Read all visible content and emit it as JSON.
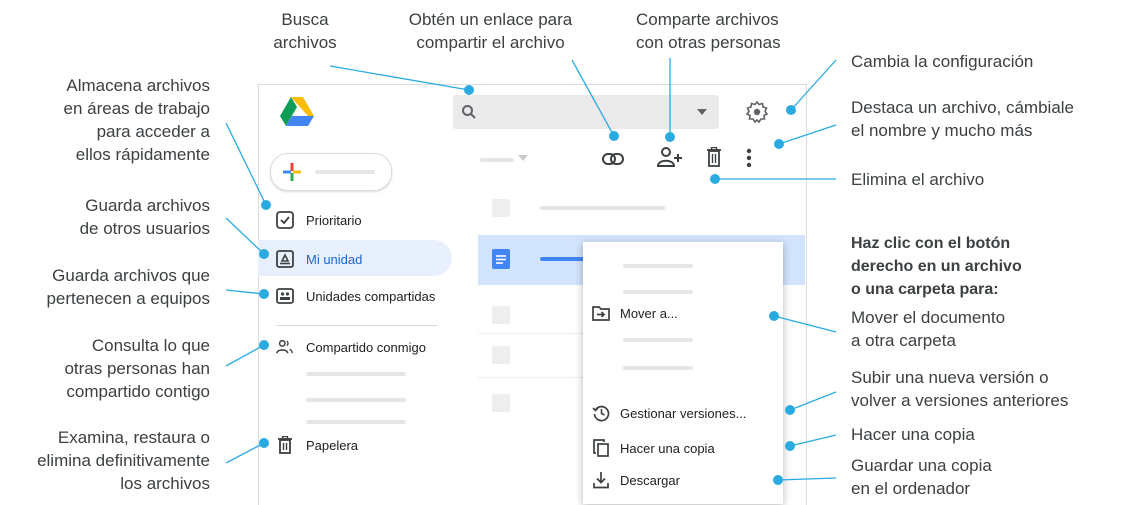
{
  "callouts": {
    "search": [
      "Busca",
      "archivos"
    ],
    "link": [
      "Obtén un enlace para",
      "compartir el archivo"
    ],
    "share": [
      "Comparte archivos",
      "con otras personas"
    ],
    "settings": [
      "Cambia la configuración"
    ],
    "more": [
      "Destaca un archivo, cámbiale",
      "el nombre y mucho más"
    ],
    "delete": [
      "Elimina el archivo"
    ],
    "workspaces": [
      "Almacena archivos",
      "en áreas de trabajo",
      "para acceder a",
      "ellos rápidamente"
    ],
    "mydrive": [
      "Guarda archivos",
      "de otros usuarios"
    ],
    "shareddrives": [
      "Guarda archivos que",
      "pertenecen a equipos"
    ],
    "sharedwithme": [
      "Consulta lo que",
      "otras personas han",
      "compartido contigo"
    ],
    "trash": [
      "Examina, restaura o",
      "elimina definitivamente",
      "los archivos"
    ],
    "rightclick": [
      "Haz clic con el botón",
      "derecho en un archivo",
      "o una carpeta para:"
    ],
    "move": [
      "Mover el documento",
      "a otra carpeta"
    ],
    "versions": [
      "Subir una nueva versión o",
      "volver a versiones anteriores"
    ],
    "copy": [
      "Hacer una copia"
    ],
    "download": [
      "Guardar una copia",
      "en el ordenador"
    ]
  },
  "sidebar": {
    "items": [
      {
        "label": "Prioritario",
        "icon": "priority-icon"
      },
      {
        "label": "Mi unidad",
        "icon": "my-drive-icon"
      },
      {
        "label": "Unidades compartidas",
        "icon": "shared-drives-icon"
      },
      {
        "label": "Compartido conmigo",
        "icon": "shared-with-me-icon"
      },
      {
        "label": "Papelera",
        "icon": "trash-icon"
      }
    ]
  },
  "context_menu": {
    "items": [
      {
        "label": "Mover a...",
        "icon": "move-to-icon"
      },
      {
        "label": "Gestionar versiones...",
        "icon": "version-history-icon"
      },
      {
        "label": "Hacer una copia",
        "icon": "copy-icon"
      },
      {
        "label": "Descargar",
        "icon": "download-icon"
      }
    ]
  },
  "colors": {
    "accent": "#1a73e8",
    "selection": "#d2e3fc",
    "highlight": "#e8f0fe",
    "leader_line": "#29abe2"
  }
}
